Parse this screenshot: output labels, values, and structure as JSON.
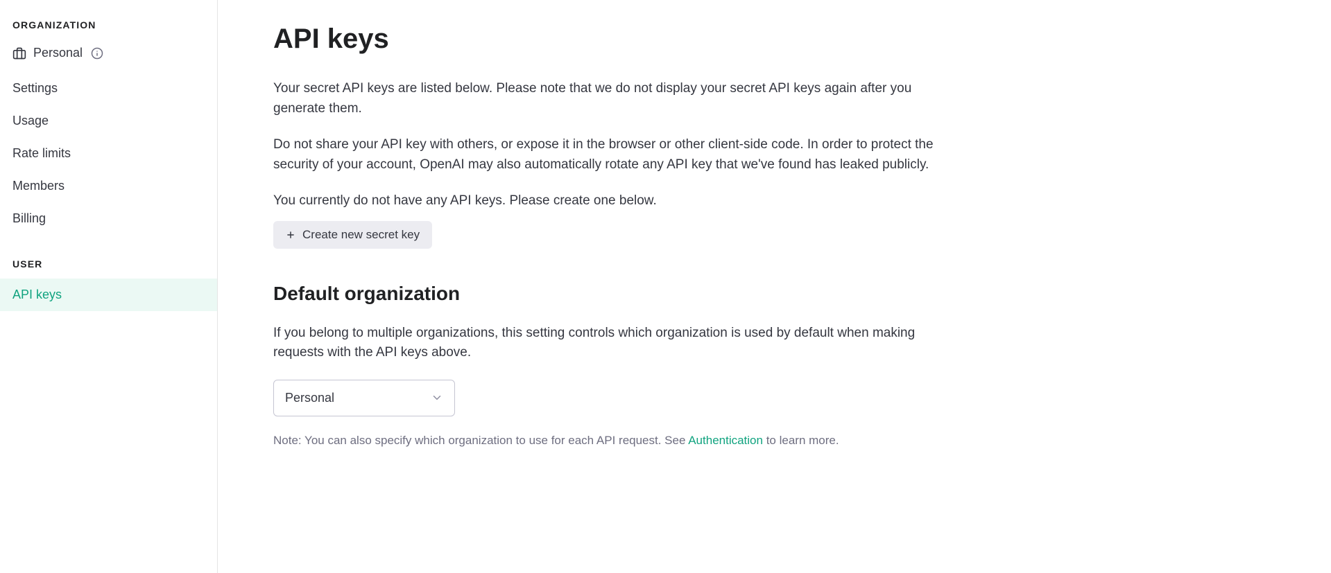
{
  "sidebar": {
    "org_header": "ORGANIZATION",
    "org_name": "Personal",
    "items": [
      {
        "label": "Settings"
      },
      {
        "label": "Usage"
      },
      {
        "label": "Rate limits"
      },
      {
        "label": "Members"
      },
      {
        "label": "Billing"
      }
    ],
    "user_header": "USER",
    "user_items": [
      {
        "label": "API keys",
        "active": true
      }
    ]
  },
  "page": {
    "title": "API keys",
    "para1": "Your secret API keys are listed below. Please note that we do not display your secret API keys again after you generate them.",
    "para2": "Do not share your API key with others, or expose it in the browser or other client-side code. In order to protect the security of your account, OpenAI may also automatically rotate any API key that we've found has leaked publicly.",
    "empty_state": "You currently do not have any API keys. Please create one below.",
    "create_button": "Create new secret key",
    "default_org_heading": "Default organization",
    "default_org_para": "If you belong to multiple organizations, this setting controls which organization is used by default when making requests with the API keys above.",
    "org_select_value": "Personal",
    "note_prefix": "Note: You can also specify which organization to use for each API request. See ",
    "note_link": "Authentication",
    "note_suffix": " to learn more."
  }
}
